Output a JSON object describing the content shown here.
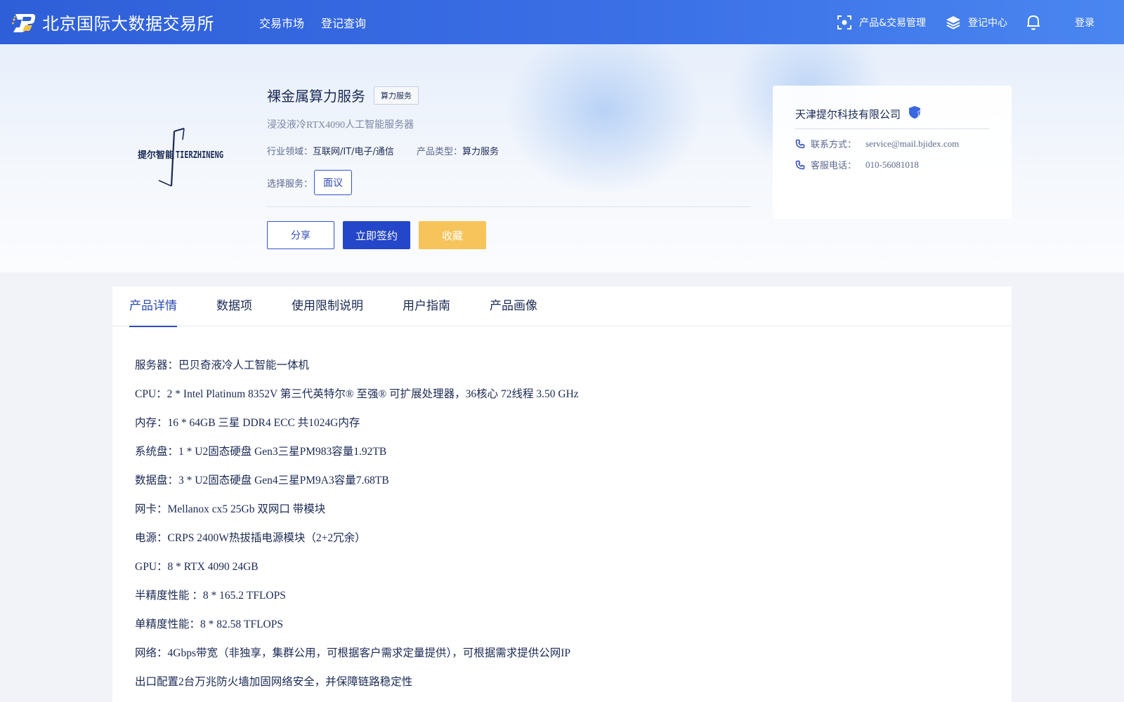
{
  "header": {
    "brand": "北京国际大数据交易所",
    "nav": [
      "交易市场",
      "登记查询"
    ],
    "right": {
      "product_mgmt": "产品&交易管理",
      "register_center": "登记中心",
      "login": "登录"
    },
    "colors": {
      "bar": "#3a6fe6",
      "logo_accent": "#f5c242"
    }
  },
  "product": {
    "title": "裸金属算力服务",
    "tag": "算力服务",
    "subtitle": "浸没液冷RTX4090人工智能服务器",
    "industry_label": "行业领域：",
    "industry_value": "互联网/IT/电子/通信",
    "type_label": "产品类型：",
    "type_value": "算力服务",
    "service_label": "选择服务：",
    "service_option": "面议",
    "buttons": {
      "share": "分享",
      "sign": "立即签约",
      "favorite": "收藏"
    },
    "logo_text_cn": "提尔智能",
    "logo_text_en": "TIERZHINENG"
  },
  "company": {
    "name": "天津提尔科技有限公司",
    "badge": "企",
    "contact_label": "联系方式：",
    "contact_value": "service@mail.bjidex.com",
    "phone_label": "客服电话：",
    "phone_value": "010-56081018"
  },
  "tabs": [
    "产品详情",
    "数据项",
    "使用限制说明",
    "用户指南",
    "产品画像"
  ],
  "active_tab": "产品详情",
  "specs": [
    "服务器：巴贝奇液冷人工智能一体机",
    "CPU：2 * Intel Platinum 8352V 第三代英特尔® 至强® 可扩展处理器，36核心 72线程 3.50 GHz",
    "内存：16 * 64GB 三星 DDR4 ECC 共1024G内存",
    "系统盘：1 * U2固态硬盘 Gen3三星PM983容量1.92TB",
    "数据盘：3 * U2固态硬盘 Gen4三星PM9A3容量7.68TB",
    "网卡：Mellanox cx5 25Gb 双网口 带模块",
    "电源：CRPS 2400W热拔插电源模块（2+2冗余）",
    "GPU：8 * RTX 4090 24GB",
    "半精度性能 ：8 * 165.2 TFLOPS",
    "单精度性能：8 * 82.58 TFLOPS",
    "网络：4Gbps带宽（非独享，集群公用，可根据客户需求定量提供），可根据需求提供公网IP",
    "出口配置2台万兆防火墙加固网络安全，并保障链路稳定性"
  ]
}
